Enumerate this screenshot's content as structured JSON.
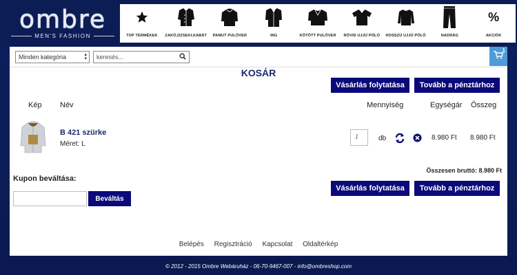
{
  "brand": {
    "name": "ombre",
    "tagline": "MEN'S FASHION"
  },
  "categories": [
    {
      "label": "TOP TERMÉKEK",
      "icon": "star-icon"
    },
    {
      "label": "ZAKÓ,DZSEKI,KABÁT",
      "icon": "jacket-icon"
    },
    {
      "label": "PAMUT PULÓVER",
      "icon": "hoodie-icon"
    },
    {
      "label": "ING",
      "icon": "shirt-icon"
    },
    {
      "label": "KÖTÖTT PULÓVER",
      "icon": "sweater-icon"
    },
    {
      "label": "RÖVID UJJÚ PÓLÓ",
      "icon": "tshirt-icon"
    },
    {
      "label": "HOSSZÚ UJJÚ PÓLÓ",
      "icon": "longsleeve-icon"
    },
    {
      "label": "NADRÁG",
      "icon": "trousers-icon"
    },
    {
      "label": "AKCIÓK",
      "icon": "percent-icon",
      "symbol": "%"
    }
  ],
  "search": {
    "category_value": "Minden kategória",
    "placeholder": "keresés..."
  },
  "cart": {
    "count": "1"
  },
  "page": {
    "title": "KOSÁR"
  },
  "buttons": {
    "continue_shopping": "Vásárlás folytatása",
    "checkout": "Tovább a pénztárhoz",
    "redeem": "Beváltás"
  },
  "table": {
    "headers": {
      "image": "Kép",
      "name": "Név",
      "quantity": "Mennyiség",
      "unit_price": "Egységár",
      "sum": "Összeg"
    },
    "rows": [
      {
        "name": "B 421 szürke",
        "size": "Méret: L",
        "quantity": "1",
        "unit": "db",
        "unit_price": "8.980 Ft",
        "sum": "8.980 Ft"
      }
    ]
  },
  "total": "Összesen bruttó: 8.980 Ft",
  "coupon": {
    "title": "Kupon beváltása:",
    "value": ""
  },
  "footer": {
    "links": [
      "Belépés",
      "Regisztráció",
      "Kapcsolat",
      "Oldaltérkép"
    ],
    "copyright": "© 2012 - 2015 Ombre Webáruház - 06-70-9467-007 - info@ombreshop.com"
  },
  "colors": {
    "background": "#0c1c55",
    "button": "#0a0a7a",
    "accent": "#4f9ad8",
    "title": "#1a2a6c"
  }
}
